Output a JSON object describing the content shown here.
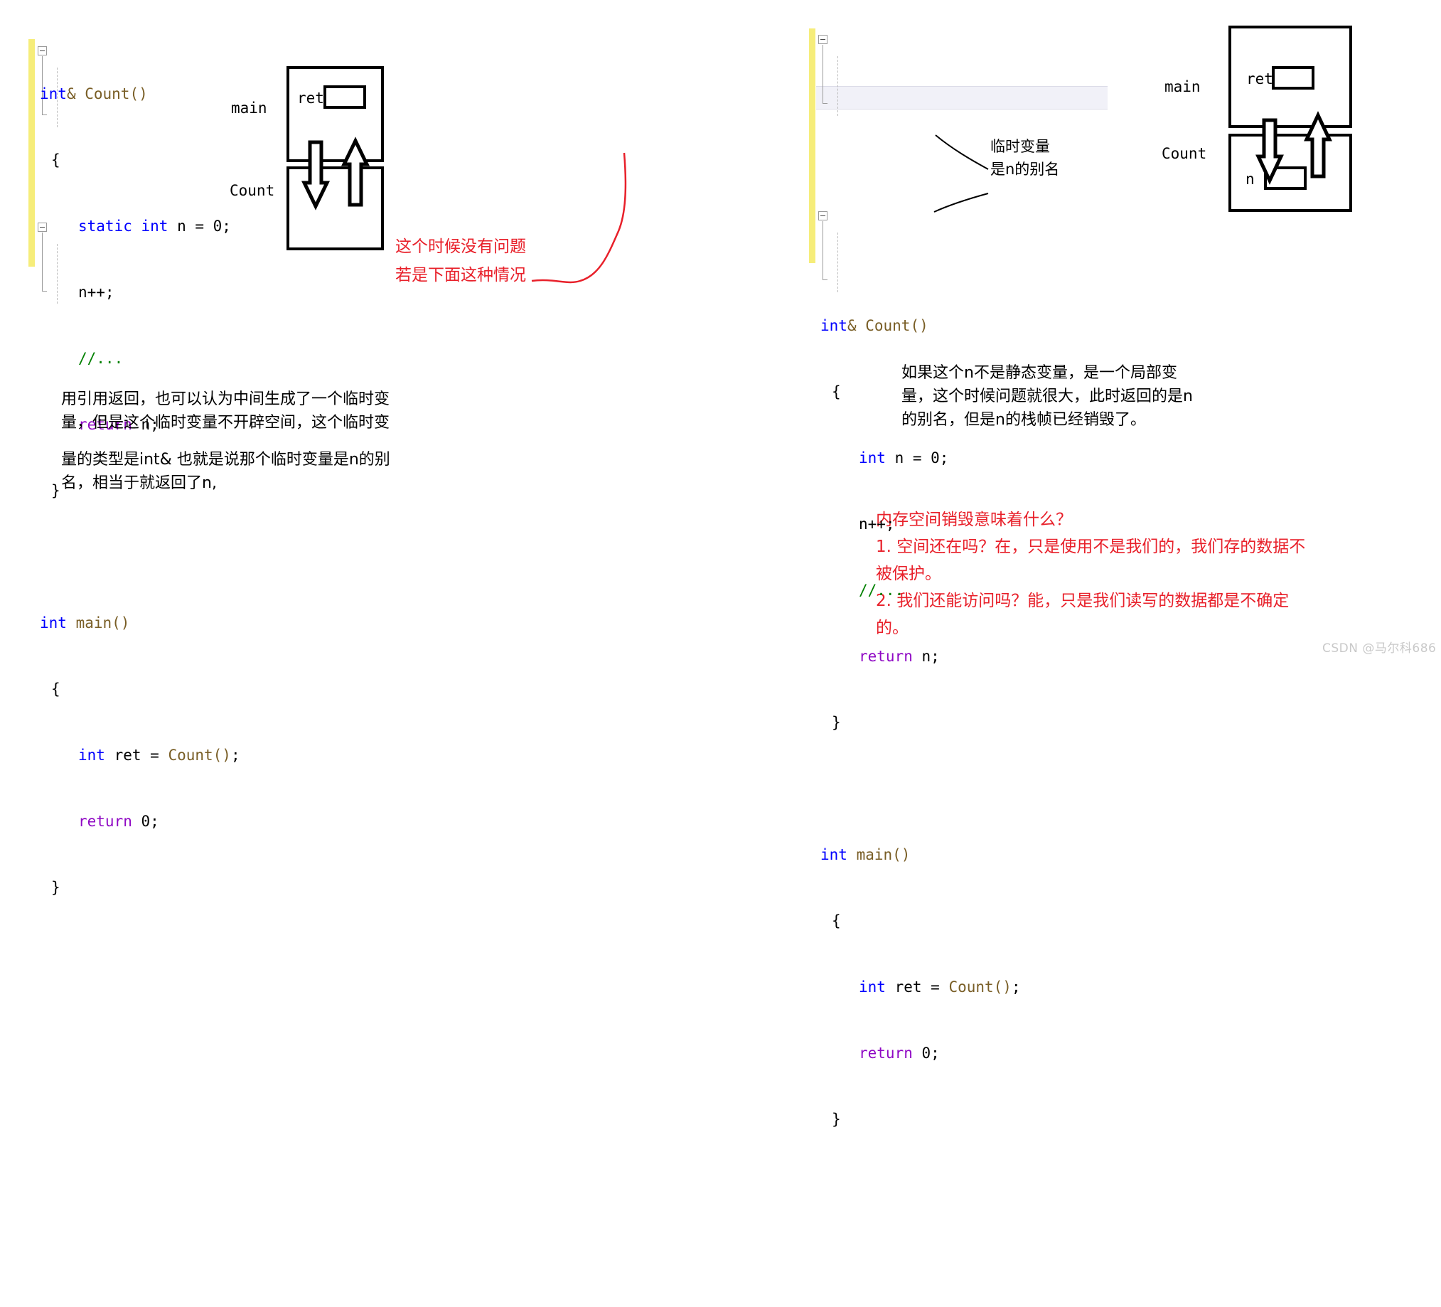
{
  "left_panel": {
    "code_lines": [
      "int& Count()",
      "{",
      "    static int n = 0;",
      "    n++;",
      "    //...",
      "    return n;",
      "}",
      "",
      "int main()",
      "{",
      "    int ret = Count();",
      "    return 0;",
      "}"
    ],
    "tokens": {
      "int": "int",
      "amp_count": "& Count()",
      "open_brace": "{",
      "close_brace": "}",
      "static": "static",
      "int2": "int",
      "n_eq_0": " n = 0;",
      "n_plus_plus": "n++;",
      "comment": "//...",
      "return": "return",
      "ret_n": " n;",
      "main": " main()",
      "ret_var": " ret = ",
      "count_call": "Count()",
      "semi": ";",
      "return_0": " 0;"
    },
    "diagram": {
      "main_label": "main",
      "count_label": "Count",
      "ret_label": "ret"
    },
    "red_notes": [
      "这个时候没有问题",
      "若是下面这种情况"
    ],
    "explanation": "用引用返回，也可以认为中间生成了一个临时变\n量，但是这个临时变量不开辟空间，这个临时变",
    "explanation2": "量的类型是int& 也就是说那个临时变量是n的别\n名，相当于就返回了n,"
  },
  "right_panel": {
    "code_lines": [
      "int& Count()",
      "{",
      "    int n = 0;",
      "    n++;",
      "    //...",
      "    return n;",
      "}",
      "",
      "int main()",
      "{",
      "    int ret = Count();",
      "    return 0;",
      "}"
    ],
    "diagram": {
      "main_label": "main",
      "count_label": "Count",
      "ret_label": "ret",
      "n_label": "n"
    },
    "callout": "临时变量\n是n的别名",
    "explanation": "如果这个n不是静态变量，是一个局部变\n量，这个时候问题就很大，此时返回的是n\n的别名，但是n的栈帧已经销毁了。",
    "red_block": "内存空间销毁意味着什么？\n1. 空间还在吗？在，只是使用不是我们的，我们存的数据不\n被保护。\n2. 我们还能访问吗？能，只是我们读写的数据都是不确定\n的。"
  },
  "watermark": "CSDN @马尔科686",
  "colors": {
    "keyword": "#0000ff",
    "control_keyword": "#8f08c4",
    "function": "#795e26",
    "comment": "#008000",
    "change_bar": "#f6ed7a",
    "red_annotation": "#e8202a",
    "highlight_line": "#f1f1f8",
    "watermark": "#c9c9c9"
  }
}
